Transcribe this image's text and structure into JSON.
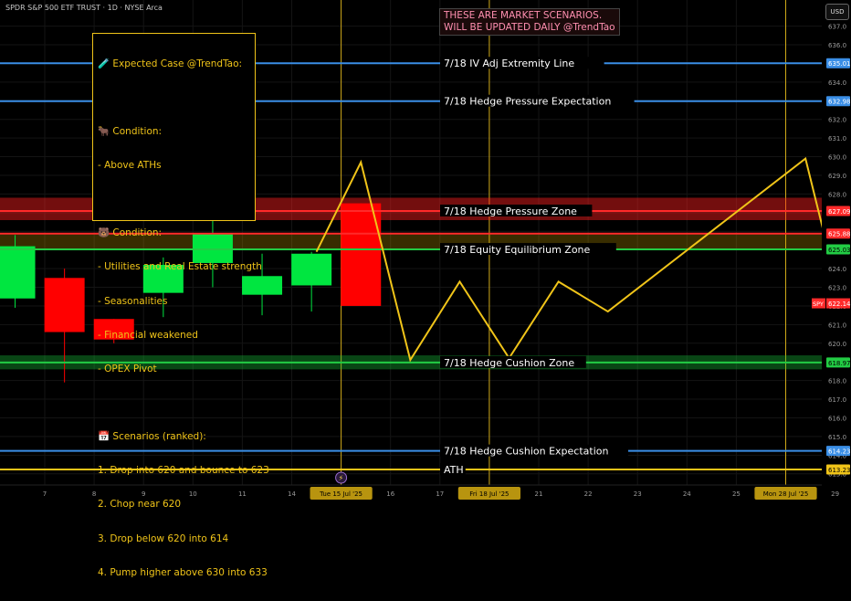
{
  "header": {
    "symbol_title": "SPDR S&P 500 ETF TRUST · 1D · NYSE Arca",
    "currency": "USD"
  },
  "banner": {
    "line1": "THESE ARE MARKET SCENARIOS.",
    "line2": "WILL BE UPDATED DAILY @TrendTao"
  },
  "notes": {
    "title": "🧪 Expected Case @TrendTao:",
    "bull_title": "🐂 Condition:",
    "bull_items": [
      "- Above ATHs"
    ],
    "bear_title": "🐻 Condition:",
    "bear_items": [
      "- Utilities and Real Estate strength",
      "- Seasonalities",
      "- Financial weakened",
      "- OPEX Pivot"
    ],
    "scen_title": "📅 Scenarios (ranked):",
    "scen_items": [
      "1. Drop into 620 and bounce to 623",
      "2. Chop near 620",
      "3. Drop below 620 into 614",
      "4. Pump higher above 630 into 633"
    ]
  },
  "colors": {
    "bull": "#00e640",
    "bear": "#ff0000",
    "gold": "#f0c419",
    "blue": "#3a8ee6",
    "red_line": "#ff2a2a",
    "green_line": "#22cc44",
    "grid": "#141414",
    "axis_text": "#9a9a9a"
  },
  "chart_data": {
    "type": "candlestick",
    "y_range": [
      612.4,
      638.4
    ],
    "y_ticks": [
      613,
      614,
      615,
      616,
      617,
      618,
      619,
      620,
      621,
      622,
      623,
      624,
      625,
      626,
      627,
      628,
      629,
      630,
      631,
      632,
      633,
      634,
      635,
      636,
      637
    ],
    "x_ticks": [
      {
        "i": 0,
        "label": "7"
      },
      {
        "i": 1,
        "label": "8"
      },
      {
        "i": 2,
        "label": "9"
      },
      {
        "i": 3,
        "label": "10"
      },
      {
        "i": 4,
        "label": "11"
      },
      {
        "i": 5,
        "label": "14"
      },
      {
        "i": 6,
        "label": "Tue 15 Jul '25"
      },
      {
        "i": 7,
        "label": "16"
      },
      {
        "i": 8,
        "label": "17"
      },
      {
        "i": 9,
        "label": "Fri 18 Jul '25"
      },
      {
        "i": 10,
        "label": "21"
      },
      {
        "i": 11,
        "label": "22"
      },
      {
        "i": 12,
        "label": "23"
      },
      {
        "i": 13,
        "label": "24"
      },
      {
        "i": 14,
        "label": "25"
      },
      {
        "i": 15,
        "label": "Mon 28 Jul '25"
      },
      {
        "i": 16,
        "label": "29"
      }
    ],
    "highlight_x": [
      6,
      9,
      15
    ],
    "candles": [
      {
        "i": -0.6,
        "o": 622.4,
        "h": 625.8,
        "l": 621.9,
        "c": 625.2
      },
      {
        "i": 0.4,
        "o": 623.5,
        "h": 624.0,
        "l": 617.9,
        "c": 620.6
      },
      {
        "i": 1.4,
        "o": 621.3,
        "h": 621.3,
        "l": 620.0,
        "c": 620.2
      },
      {
        "i": 2.4,
        "o": 622.7,
        "h": 624.6,
        "l": 621.4,
        "c": 624.2
      },
      {
        "i": 3.4,
        "o": 624.3,
        "h": 627.2,
        "l": 623.0,
        "c": 625.9
      },
      {
        "i": 4.4,
        "o": 622.6,
        "h": 624.8,
        "l": 621.5,
        "c": 623.6
      },
      {
        "i": 5.4,
        "o": 623.1,
        "h": 624.9,
        "l": 621.7,
        "c": 624.8
      },
      {
        "i": 6.4,
        "o": 627.5,
        "h": 627.5,
        "l": 622.0,
        "c": 622.0
      }
    ],
    "scenario_path": [
      {
        "i": 5.5,
        "v": 624.9
      },
      {
        "i": 6.4,
        "v": 629.7
      },
      {
        "i": 7.4,
        "v": 619.1
      },
      {
        "i": 8.4,
        "v": 623.3
      },
      {
        "i": 9.4,
        "v": 619.2
      },
      {
        "i": 10.4,
        "v": 623.3
      },
      {
        "i": 11.4,
        "v": 621.7
      },
      {
        "i": 15.4,
        "v": 629.9
      },
      {
        "i": 16.4,
        "v": 619.2
      }
    ],
    "levels": [
      {
        "label": "7/18 IV Adj Extremity Line",
        "v": 635.01,
        "style": "blue",
        "tag": "635.01"
      },
      {
        "label": "7/18 Hedge Pressure Expectation",
        "v": 632.98,
        "style": "blue",
        "tag": "632.98"
      },
      {
        "label": "7/18 Hedge Pressure Zone",
        "v": 627.09,
        "style": "redzone",
        "tag": "627.09",
        "zone": [
          626.6,
          627.8
        ]
      },
      {
        "label": "",
        "v": 625.88,
        "style": "redline",
        "tag": "625.88"
      },
      {
        "label": "7/18 Equity Equilibrium Zone",
        "v": 625.03,
        "style": "greenline",
        "tag": "625.03",
        "zone": [
          625.0,
          625.85
        ]
      },
      {
        "label": "7/18 Hedge Cushion Zone",
        "v": 618.97,
        "style": "greenzone",
        "tag": "618.97",
        "zone": [
          618.6,
          619.35
        ]
      },
      {
        "label": "7/18 Hedge Cushion Expectation",
        "v": 614.23,
        "style": "blue",
        "tag": "614.23"
      },
      {
        "label": "ATH",
        "v": 613.23,
        "style": "gold",
        "tag": "613.23"
      }
    ],
    "last_price": {
      "label": "SPY",
      "v": 622.14,
      "tag": "622.14"
    }
  }
}
